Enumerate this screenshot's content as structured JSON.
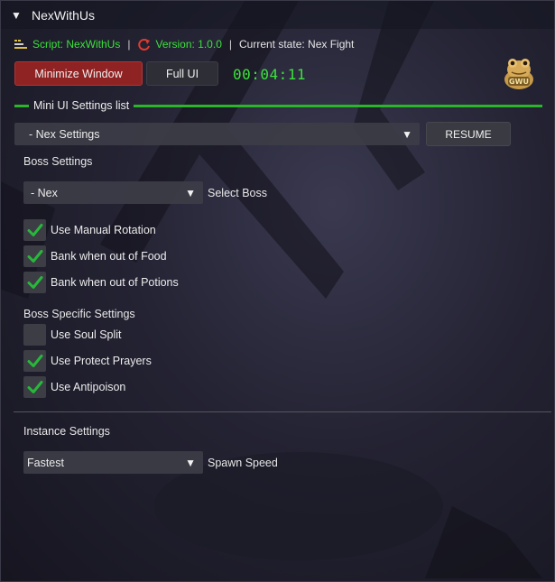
{
  "window": {
    "title": "NexWithUs"
  },
  "info": {
    "script_label": "Script: NexWithUs",
    "version_label": "Version: 1.0.0",
    "state_label": "Current state: Nex Fight"
  },
  "controls": {
    "minimize_label": "Minimize Window",
    "full_ui_label": "Full UI",
    "timer": "00:04:11"
  },
  "logo": {
    "text": "GWU"
  },
  "mini_ui": {
    "section_label": "Mini UI Settings list",
    "selected": "- Nex Settings",
    "resume_label": "RESUME"
  },
  "boss_settings": {
    "heading": "Boss Settings",
    "boss_select_value": "- Nex",
    "boss_select_label": "Select Boss",
    "options": [
      {
        "label": "Use Manual Rotation",
        "checked": true
      },
      {
        "label": "Bank when out of Food",
        "checked": true
      },
      {
        "label": "Bank when out of Potions",
        "checked": true
      }
    ]
  },
  "boss_specific": {
    "heading": "Boss Specific Settings",
    "options": [
      {
        "label": "Use Soul Split",
        "checked": false
      },
      {
        "label": "Use Protect Prayers",
        "checked": true
      },
      {
        "label": "Use Antipoison",
        "checked": true
      }
    ]
  },
  "instance": {
    "heading": "Instance Settings",
    "speed_value": "Fastest",
    "speed_label": "Spawn Speed"
  },
  "colors": {
    "accent_green": "#3be23b",
    "section_line": "#2bb52b",
    "minimize_red": "#8f2222"
  },
  "icons": {
    "collapse": "triangle-down-icon",
    "script": "script-icon",
    "version": "refresh-icon",
    "caret": "caret-down-icon",
    "check": "checkmark-icon"
  }
}
